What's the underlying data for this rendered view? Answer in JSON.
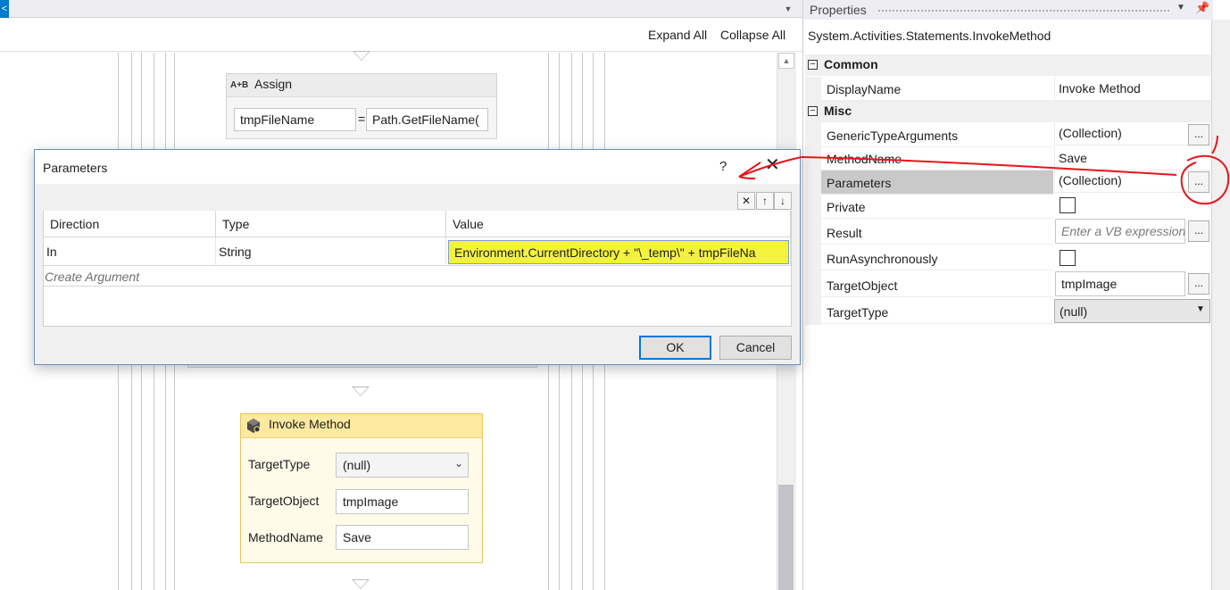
{
  "designer": {
    "expand_all": "Expand All",
    "collapse_all": "Collapse All",
    "assign": {
      "icon_text": "A+B",
      "title": "Assign",
      "to": "tmpFileName",
      "equals": "=",
      "value": "Path.GetFileName("
    },
    "invoke_method": {
      "title": "Invoke Method",
      "target_type_label": "TargetType",
      "target_type_value": "(null)",
      "target_object_label": "TargetObject",
      "target_object_value": "tmpImage",
      "method_name_label": "MethodName",
      "method_name_value": "Save"
    }
  },
  "parameters_dialog": {
    "title": "Parameters",
    "help": "?",
    "close": "✕",
    "toolbar": {
      "delete": "✕",
      "up": "↑",
      "down": "↓"
    },
    "columns": [
      "Direction",
      "Type",
      "Value"
    ],
    "rows": [
      {
        "direction": "In",
        "type": "String",
        "value": "Environment.CurrentDirectory + \"\\_temp\\\" + tmpFileNa"
      }
    ],
    "create_argument": "Create Argument",
    "ok": "OK",
    "cancel": "Cancel",
    "highlight_color": "#f4f33b"
  },
  "properties": {
    "title": "Properties",
    "object_type": "System.Activities.Statements.InvokeMethod",
    "categories": {
      "common": "Common",
      "misc": "Misc"
    },
    "rows": {
      "display_name": {
        "name": "DisplayName",
        "value": "Invoke Method"
      },
      "generic_type_arguments": {
        "name": "GenericTypeArguments",
        "value": "(Collection)"
      },
      "method_name": {
        "name": "MethodName",
        "value": "Save"
      },
      "parameters": {
        "name": "Parameters",
        "value": "(Collection)"
      },
      "private": {
        "name": "Private"
      },
      "result": {
        "name": "Result",
        "placeholder": "Enter a VB expression"
      },
      "run_asynchronously": {
        "name": "RunAsynchronously"
      },
      "target_object": {
        "name": "TargetObject",
        "value": "tmpImage"
      },
      "target_type": {
        "name": "TargetType",
        "value": "(null)"
      }
    },
    "ellipsis": "..."
  },
  "annotation_color": "#e8141b"
}
